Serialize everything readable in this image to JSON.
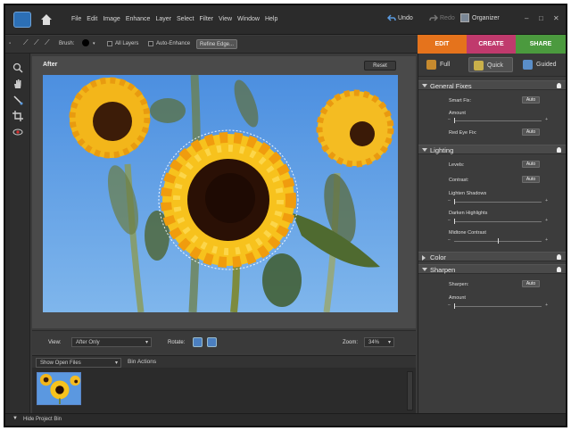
{
  "menu": [
    "File",
    "Edit",
    "Image",
    "Enhance",
    "Layer",
    "Select",
    "Filter",
    "View",
    "Window",
    "Help"
  ],
  "header": {
    "undo": "Undo",
    "redo": "Redo",
    "organizer": "Organizer",
    "minimize": "–",
    "restore": "□",
    "close": "✕"
  },
  "options": {
    "brush_label": "Brush:",
    "all_layers": "All Layers",
    "auto_enhance": "Auto-Enhance",
    "refine_edge": "Refine Edge..."
  },
  "mode_tabs": [
    {
      "label": "EDIT",
      "color": "#e5731c"
    },
    {
      "label": "CREATE",
      "color": "#c03a6d"
    },
    {
      "label": "SHARE",
      "color": "#4b9a3e"
    }
  ],
  "document": {
    "title": "After",
    "reset": "Reset"
  },
  "view": {
    "view_label": "View:",
    "view_value": "After Only",
    "rotate_label": "Rotate:",
    "zoom_label": "Zoom:",
    "zoom_value": "34%"
  },
  "bin": {
    "show_value": "Show Open Files",
    "bin_actions": "Bin Actions",
    "hide_bin": "Hide Project Bin"
  },
  "edit_modes": [
    {
      "label": "Full"
    },
    {
      "label": "Quick"
    },
    {
      "label": "Guided"
    }
  ],
  "panel": {
    "general_fixes": {
      "title": "General Fixes",
      "smart_fix": "Smart Fix:",
      "amount": "Amount",
      "red_eye": "Red Eye Fix:"
    },
    "lighting": {
      "title": "Lighting",
      "levels": "Levels:",
      "contrast": "Contrast:",
      "lighten_shadows": "Lighten Shadows",
      "darken_highlights": "Darken Highlights",
      "midtone_contrast": "Midtone Contrast"
    },
    "color": {
      "title": "Color"
    },
    "sharpen": {
      "title": "Sharpen",
      "sharpen": "Sharpen:",
      "amount": "Amount"
    },
    "auto_label": "Auto"
  },
  "sliders": {
    "smart_fix_amount": 0.0,
    "lighten_shadows": 0.0,
    "darken_highlights": 0.0,
    "midtone_contrast": 0.5,
    "sharpen_amount": 0.0
  }
}
